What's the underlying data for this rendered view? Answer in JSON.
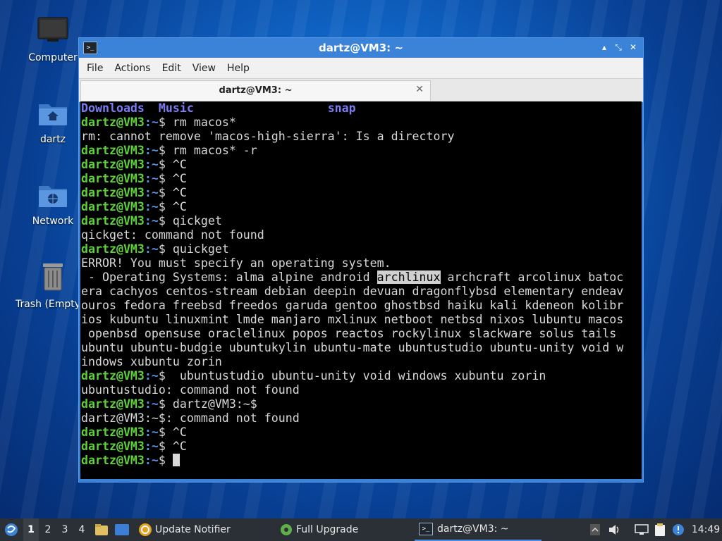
{
  "desktop": {
    "icons": [
      {
        "label": "Computer"
      },
      {
        "label": "dartz"
      },
      {
        "label": "Network"
      },
      {
        "label": "Trash (Empty)"
      }
    ]
  },
  "window": {
    "title": "dartz@VM3: ~",
    "controls": {
      "minimize": "▴",
      "maximize": "⤡",
      "close": "✕"
    },
    "menu": [
      "File",
      "Actions",
      "Edit",
      "View",
      "Help"
    ],
    "tab": {
      "label": "dartz@VM3: ~",
      "close": "✕"
    }
  },
  "terminal": {
    "prompt_user": "dartz@VM3",
    "prompt_path": ":~",
    "prompt_dollar": "$ ",
    "dirs": [
      "Downloads",
      "Music",
      "snap"
    ],
    "lines": [
      {
        "t": "p",
        "cmd": "rm macos*"
      },
      {
        "t": "o",
        "text": "rm: cannot remove 'macos-high-sierra': Is a directory"
      },
      {
        "t": "p",
        "cmd": "rm macos* -r"
      },
      {
        "t": "p",
        "cmd": "^C"
      },
      {
        "t": "p",
        "cmd": "^C"
      },
      {
        "t": "p",
        "cmd": "^C"
      },
      {
        "t": "p",
        "cmd": "^C"
      },
      {
        "t": "p",
        "cmd": "qickget"
      },
      {
        "t": "o",
        "text": "qickget: command not found"
      },
      {
        "t": "p",
        "cmd": "quickget"
      },
      {
        "t": "o",
        "text": "ERROR! You must specify an operating system."
      },
      {
        "t": "sel",
        "before": " - Operating Systems: alma alpine android ",
        "selected": "archlinux",
        "after": " archcraft arcolinux batoc"
      },
      {
        "t": "o",
        "text": "era cachyos centos-stream debian deepin devuan dragonflybsd elementary endeav"
      },
      {
        "t": "o",
        "text": "ouros fedora freebsd freedos garuda gentoo ghostbsd haiku kali kdeneon kolibr"
      },
      {
        "t": "o",
        "text": "ios kubuntu linuxmint lmde manjaro mxlinux netboot netbsd nixos lubuntu macos"
      },
      {
        "t": "o",
        "text": " openbsd opensuse oraclelinux popos reactos rockylinux slackware solus tails"
      },
      {
        "t": "o",
        "text": "ubuntu ubuntu-budgie ubuntukylin ubuntu-mate ubuntustudio ubuntu-unity void w"
      },
      {
        "t": "o",
        "text": "indows xubuntu zorin"
      },
      {
        "t": "p",
        "cmd": " ubuntustudio ubuntu-unity void windows xubuntu zorin"
      },
      {
        "t": "o",
        "text": "ubuntustudio: command not found"
      },
      {
        "t": "p",
        "cmd": "dartz@VM3:~$"
      },
      {
        "t": "o",
        "text": "dartz@VM3:~$: command not found"
      },
      {
        "t": "p",
        "cmd": "^C"
      },
      {
        "t": "p",
        "cmd": "^C"
      },
      {
        "t": "p",
        "cmd": "",
        "cursor": true
      }
    ]
  },
  "taskbar": {
    "workspaces": [
      "1",
      "2",
      "3",
      "4"
    ],
    "active_workspace": "1",
    "tasks": [
      {
        "label": "Update Notifier",
        "icon": "update-notifier-icon"
      },
      {
        "label": "Full Upgrade",
        "icon": "gear-icon"
      },
      {
        "label": "dartz@VM3: ~",
        "icon": "terminal-icon",
        "active": true
      }
    ],
    "clock": "14:49"
  }
}
